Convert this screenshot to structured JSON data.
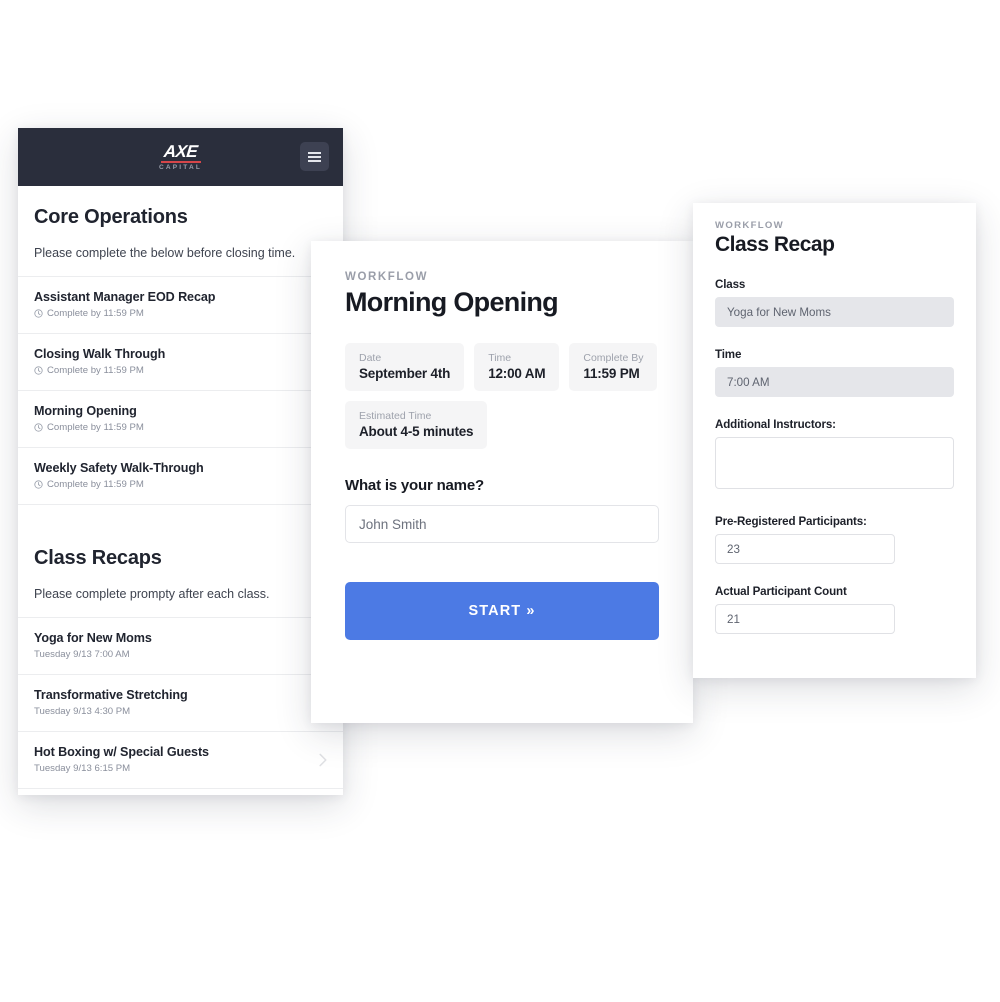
{
  "app": {
    "logo_main": "AXE",
    "logo_sub": "CAPITAL",
    "menu_icon": "hamburger-icon"
  },
  "task_list": {
    "sections": [
      {
        "title": "Core Operations",
        "subtitle": "Please complete the below before closing time.",
        "items": [
          {
            "title": "Assistant Manager EOD Recap",
            "meta": "Complete by 11:59 PM",
            "icon": "clock-icon",
            "chevron": false
          },
          {
            "title": "Closing Walk Through",
            "meta": "Complete by 11:59 PM",
            "icon": "clock-icon",
            "chevron": false
          },
          {
            "title": "Morning Opening",
            "meta": "Complete by 11:59 PM",
            "icon": "clock-icon",
            "chevron": false
          },
          {
            "title": "Weekly Safety Walk-Through",
            "meta": "Complete by 11:59 PM",
            "icon": "clock-icon",
            "chevron": false
          }
        ]
      },
      {
        "title": "Class Recaps",
        "subtitle": "Please complete prompty after each class.",
        "items": [
          {
            "title": "Yoga for New Moms",
            "meta": "Tuesday 9/13 7:00 AM",
            "icon": "",
            "chevron": false
          },
          {
            "title": "Transformative Stretching",
            "meta": "Tuesday 9/13 4:30 PM",
            "icon": "",
            "chevron": false
          },
          {
            "title": "Hot Boxing w/ Special Guests",
            "meta": "Tuesday 9/13 6:15 PM",
            "icon": "",
            "chevron": true
          }
        ]
      }
    ]
  },
  "workflow_start": {
    "kicker": "WORKFLOW",
    "title": "Morning Opening",
    "chips": [
      {
        "label": "Date",
        "value": "September 4th"
      },
      {
        "label": "Time",
        "value": "12:00 AM"
      },
      {
        "label": "Complete By",
        "value": "11:59 PM"
      },
      {
        "label": "Estimated Time",
        "value": "About 4-5 minutes"
      }
    ],
    "question_label": "What is your name?",
    "name_placeholder": "John Smith",
    "name_value": "",
    "start_label": "START »"
  },
  "class_recap": {
    "kicker": "WORKFLOW",
    "title": "Class Recap",
    "fields": [
      {
        "label": "Class",
        "value": "Yoga for New Moms",
        "style": "filled",
        "type": "input"
      },
      {
        "label": "Time",
        "value": "7:00 AM",
        "style": "filled",
        "type": "input"
      },
      {
        "label": "Additional Instructors:",
        "value": "",
        "style": "open",
        "type": "textarea"
      },
      {
        "label": "Pre-Registered Participants:",
        "value": "23",
        "style": "open narrow",
        "type": "input"
      },
      {
        "label": "Actual Participant Count",
        "value": "21",
        "style": "open narrow",
        "type": "input"
      }
    ]
  },
  "colors": {
    "header_bg": "#2a2e3c",
    "accent_blue": "#4c7ae4",
    "logo_rule_red": "#d6464a",
    "field_filled": "#e5e6ea"
  }
}
